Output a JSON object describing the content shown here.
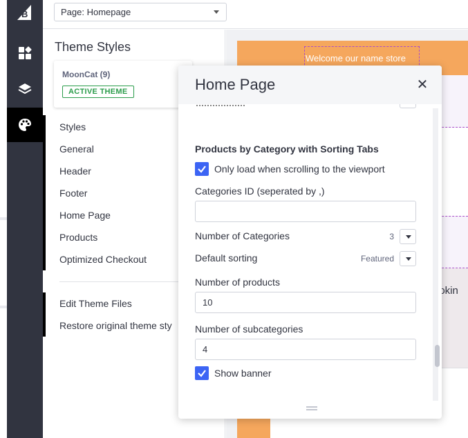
{
  "app": {
    "rail_icons": [
      "bigcommerce-logo",
      "dashboard-icon",
      "layers-icon",
      "palette-icon"
    ]
  },
  "topbar": {
    "page_select_value": "Page: Homepage"
  },
  "panel": {
    "title": "Theme Styles",
    "theme_card": {
      "name": "MoonCat (9)",
      "badge": "ACTIVE THEME"
    },
    "menu": [
      {
        "label": "Styles"
      },
      {
        "label": "General"
      },
      {
        "label": "Header"
      },
      {
        "label": "Footer"
      },
      {
        "label": "Home Page"
      },
      {
        "label": "Products"
      },
      {
        "label": "Optimized Checkout"
      }
    ],
    "secondary_menu": [
      {
        "label": "Edit Theme Files"
      },
      {
        "label": "Restore original theme sty"
      }
    ]
  },
  "preview": {
    "welcome_text": "Welcome our name store",
    "partial_text": "ookin"
  },
  "modal": {
    "title": "Home Page",
    "close_glyph": "✕",
    "section_title": "Products by Category with Sorting Tabs",
    "lazy_load": {
      "label": "Only load when scrolling to the viewport",
      "checked": true
    },
    "categories_id": {
      "label": "Categories ID (seperated by ,)",
      "value": "",
      "placeholder": ""
    },
    "num_categories": {
      "label": "Number of Categories",
      "value": "3"
    },
    "default_sorting": {
      "label": "Default sorting",
      "value": "Featured"
    },
    "num_products": {
      "label": "Number of products",
      "value": "10"
    },
    "num_subcategories": {
      "label": "Number of subcategories",
      "value": "4"
    },
    "show_banner": {
      "label": "Show banner",
      "checked": true
    }
  },
  "colors": {
    "rail": "#313440",
    "accent_blue": "#3c64f4",
    "active_green": "#2a9c4a",
    "preview_orange": "#f5a75d",
    "selection_purple": "#a94dc9"
  }
}
